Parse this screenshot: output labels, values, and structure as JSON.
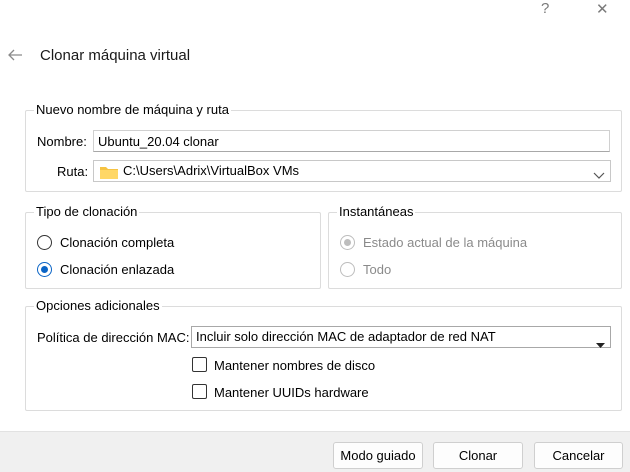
{
  "window": {
    "help_glyph": "?",
    "close_glyph": "✕"
  },
  "dialog": {
    "title": "Clonar máquina virtual"
  },
  "name_path_group": {
    "title": "Nuevo nombre de máquina y ruta",
    "name_label": "Nombre:",
    "name_value": "Ubuntu_20.04 clonar",
    "path_label": "Ruta:",
    "path_value": "C:\\Users\\Adrix\\VirtualBox VMs"
  },
  "clone_type_group": {
    "title": "Tipo de clonación",
    "options": [
      {
        "label": "Clonación completa",
        "checked": false
      },
      {
        "label": "Clonación enlazada",
        "checked": true
      }
    ]
  },
  "snapshots_group": {
    "title": "Instantáneas",
    "options": [
      {
        "label": "Estado actual de la máquina",
        "checked": true,
        "disabled": true
      },
      {
        "label": "Todo",
        "checked": false,
        "disabled": true
      }
    ]
  },
  "additional_group": {
    "title": "Opciones adicionales",
    "mac_label": "Política de dirección MAC:",
    "mac_value": "Incluir solo dirección MAC de adaptador de red NAT",
    "keep_disk_names_label": "Mantener nombres de disco",
    "keep_disk_names_checked": false,
    "keep_uuids_label": "Mantener UUIDs hardware",
    "keep_uuids_checked": false
  },
  "buttons": {
    "guided": "Modo guiado",
    "clone": "Clonar",
    "cancel": "Cancelar"
  },
  "colors": {
    "accent": "#0a64c6",
    "folder": "#f6c342"
  }
}
